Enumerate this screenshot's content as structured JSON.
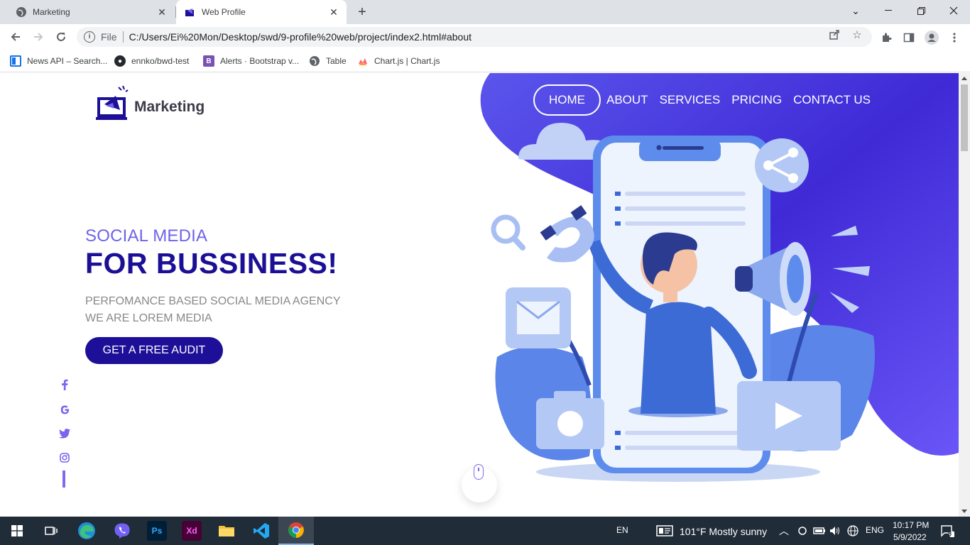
{
  "browser": {
    "tabs": [
      {
        "title": "Marketing",
        "active": false,
        "favicon": "globe-icon"
      },
      {
        "title": "Web Profile",
        "active": true,
        "favicon": "megaphone-logo-icon"
      }
    ],
    "new_tab": "+",
    "window_controls": {
      "minimize": "—",
      "restore": "❐",
      "close": "✕",
      "tab_search": "⌄"
    },
    "omnibox": {
      "scheme_label": "File",
      "url": "C:/Users/Ei%20Mon/Desktop/swd/9-profile%20web/project/index2.html#about"
    },
    "bookmarks": [
      {
        "label": "News API – Search...",
        "icon": "news-icon",
        "color": "#1a73e8"
      },
      {
        "label": "ennko/bwd-test",
        "icon": "github-icon",
        "color": "#24292e"
      },
      {
        "label": "Alerts · Bootstrap v...",
        "icon": "bootstrap-icon",
        "color": "#7952b3"
      },
      {
        "label": "Table",
        "icon": "globe-icon",
        "color": "#5f6368"
      },
      {
        "label": "Chart.js | Chart.js",
        "icon": "chartjs-icon",
        "color": "#ff6384"
      }
    ]
  },
  "page": {
    "logo_text": "Marketing",
    "nav": [
      "HOME",
      "ABOUT",
      "SERVICES",
      "PRICING",
      "CONTACT US"
    ],
    "hero": {
      "subtitle": "SOCIAL MEDIA",
      "title": "FOR BUSSINESS!",
      "desc_line1": "PERFOMANCE BASED SOCIAL MEDIA AGENCY",
      "desc_line2": "WE ARE LOREM MEDIA",
      "cta": "GET A FREE AUDIT"
    },
    "social": [
      {
        "icon": "facebook-icon",
        "glyph": "f"
      },
      {
        "icon": "google-icon",
        "glyph": "G"
      },
      {
        "icon": "twitter-icon",
        "glyph": "🐦"
      },
      {
        "icon": "instagram-icon",
        "glyph": "◎"
      }
    ],
    "colors": {
      "primary": "#1d0f97",
      "accent": "#6f63e8",
      "blob": "#5a4be8"
    }
  },
  "taskbar": {
    "lang_indicator": "EN",
    "weather": "101°F  Mostly sunny",
    "lang": "ENG",
    "time": "10:17 PM",
    "date": "5/9/2022",
    "notifications": "8"
  }
}
